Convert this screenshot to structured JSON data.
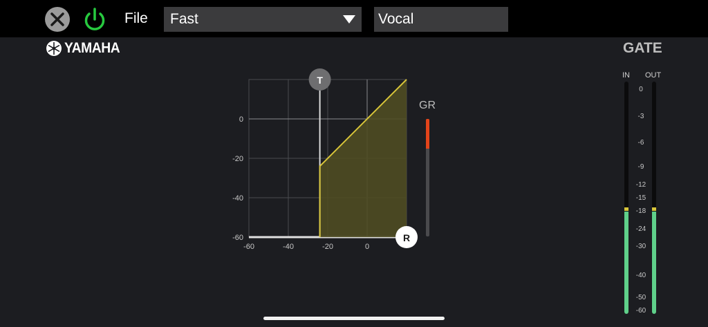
{
  "toolbar": {
    "close_icon": "close-icon",
    "power_icon": "power-icon",
    "file_label": "File",
    "preset_value": "Fast",
    "name_value": "Vocal"
  },
  "brand": {
    "logo_text": "YAMAHA"
  },
  "title": "GATE",
  "graph": {
    "x_ticks": [
      "-60",
      "-40",
      "-20",
      "0"
    ],
    "y_ticks": [
      "0",
      "-20",
      "-40",
      "-60"
    ],
    "threshold_handle": "T",
    "range_handle": "R",
    "threshold_db": -24,
    "range_db": -60,
    "x_min": -60,
    "x_max": 20,
    "y_min": -60,
    "y_max": 20
  },
  "gr": {
    "label": "GR",
    "level_fraction": 0.25
  },
  "meters": {
    "in_label": "IN",
    "out_label": "OUT",
    "scale": [
      "0",
      "-3",
      "-6",
      "-9",
      "-12",
      "-15",
      "-18",
      "-24",
      "-30",
      "-40",
      "-50",
      "-60"
    ],
    "in_peak_db": -18,
    "out_peak_db": -18,
    "in_level_db": -18,
    "out_level_db": -18
  },
  "colors": {
    "curve": "#d8c53a",
    "curve_fill": "#4f4d22",
    "gr_fill": "#e3441a",
    "meter_fill": "#5fd08a",
    "power_on": "#27c93f"
  }
}
